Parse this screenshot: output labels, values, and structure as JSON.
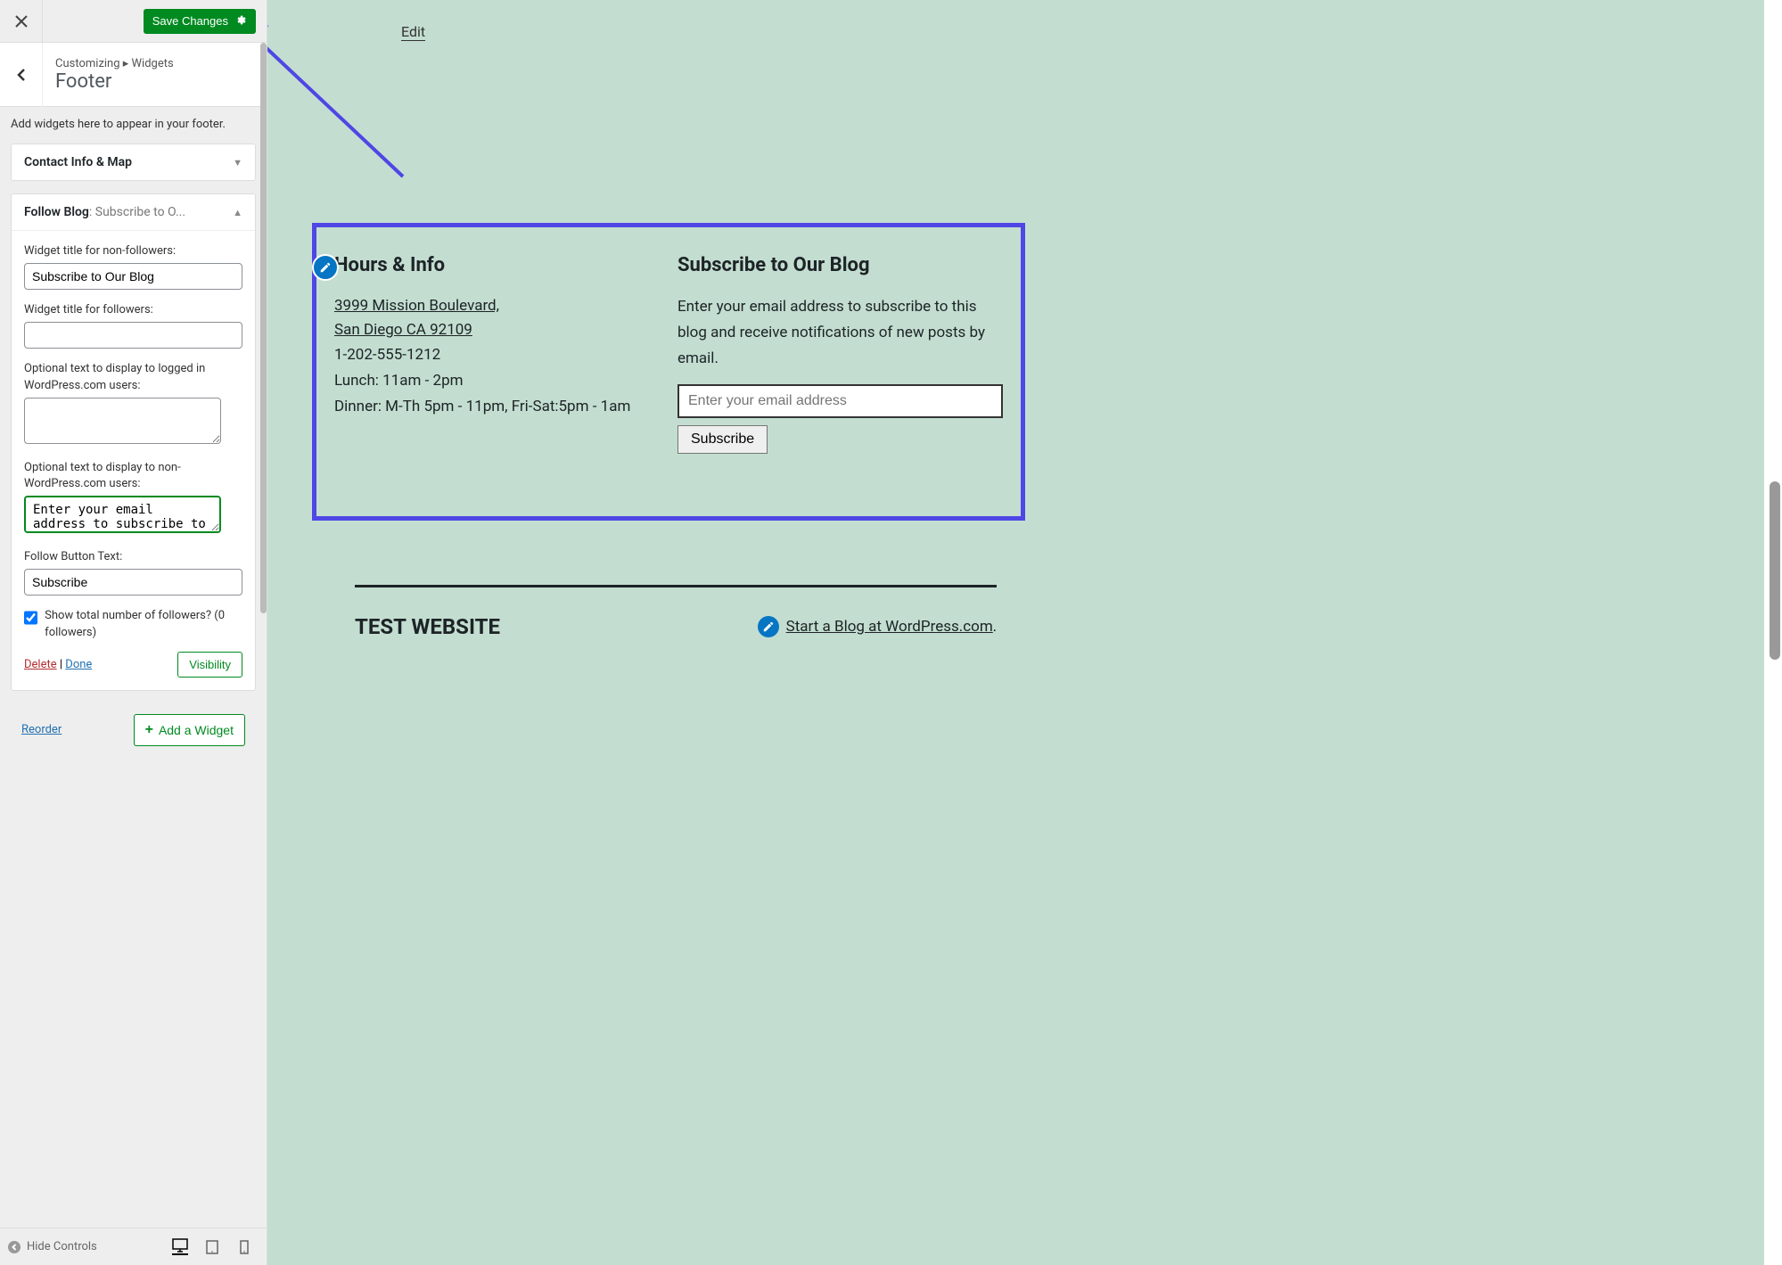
{
  "header": {
    "save_label": "Save Changes"
  },
  "breadcrumb": {
    "path_a": "Customizing",
    "path_b": "Widgets",
    "title": "Footer"
  },
  "sidebar": {
    "description": "Add widgets here to appear in your footer.",
    "reorder": "Reorder",
    "add_widget": "Add a Widget"
  },
  "widgets": {
    "contact": {
      "title": "Contact Info & Map"
    },
    "follow": {
      "title_prefix": "Follow Blog",
      "title_suffix": ": Subscribe to O...",
      "fields": {
        "non_followers_label": "Widget title for non-followers:",
        "non_followers_value": "Subscribe to Our Blog",
        "followers_label": "Widget title for followers:",
        "followers_value": "",
        "logged_in_label": "Optional text to display to logged in WordPress.com users:",
        "logged_in_value": "",
        "non_wp_label": "Optional text to display to non-WordPress.com users:",
        "non_wp_value": "Enter your email address to subscribe to this blog and",
        "button_text_label": "Follow Button Text:",
        "button_text_value": "Subscribe",
        "checkbox_label": "Show total number of followers? (0 followers)"
      },
      "actions": {
        "delete": "Delete",
        "done": "Done",
        "visibility": "Visibility"
      }
    }
  },
  "bottom_bar": {
    "hide_controls": "Hide Controls"
  },
  "preview": {
    "edit": "Edit",
    "hours": {
      "title": "Hours & Info",
      "addr1": "3999 Mission Boulevard,",
      "addr2": "San Diego CA 92109",
      "phone": "1-202-555-1212",
      "lunch": "Lunch: 11am - 2pm",
      "dinner": "Dinner: M-Th 5pm - 11pm, Fri-Sat:5pm - 1am"
    },
    "subscribe": {
      "title": "Subscribe to Our Blog",
      "desc": "Enter your email address to subscribe to this blog and receive notifications of new posts by email.",
      "placeholder": "Enter your email address",
      "button": "Subscribe"
    },
    "footer": {
      "site_title": "TEST WEBSITE",
      "wp_text": "Start a Blog at WordPress.com",
      "period": "."
    }
  }
}
